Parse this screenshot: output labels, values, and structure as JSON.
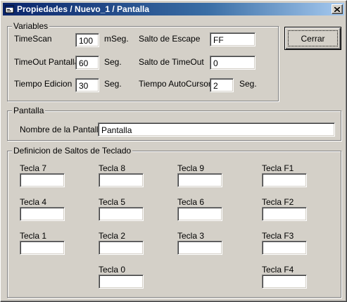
{
  "window": {
    "title": "Propiedades / Nuevo_1 / Pantalla",
    "icons": {
      "app": "app-window-icon",
      "close": "close-x-icon"
    }
  },
  "variables": {
    "legend": "Variables",
    "timescan_label": "TimeScan",
    "timescan_value": "100",
    "timescan_unit": "mSeg.",
    "timeout_label": "TimeOut Pantalla",
    "timeout_value": "60",
    "timeout_unit": "Seg.",
    "edicion_label": "Tiempo Edicion",
    "edicion_value": "30",
    "edicion_unit": "Seg.",
    "salto_escape_label": "Salto de Escape",
    "salto_escape_value": "FF",
    "salto_timeout_label": "Salto de TimeOut",
    "salto_timeout_value": "0",
    "autocursor_label": "Tiempo AutoCursor",
    "autocursor_value": "2",
    "autocursor_unit": "Seg."
  },
  "buttons": {
    "close_label": "Cerrar"
  },
  "pantalla": {
    "legend": "Pantalla",
    "name_label": "Nombre de la Pantalla:",
    "name_value": "Pantalla"
  },
  "saltos": {
    "legend": "Definicion de Saltos de Teclado",
    "keys": [
      {
        "label": "Tecla 7",
        "value": ""
      },
      {
        "label": "Tecla 8",
        "value": ""
      },
      {
        "label": "Tecla 9",
        "value": ""
      },
      {
        "label": "Tecla F1",
        "value": ""
      },
      {
        "label": "Tecla 4",
        "value": ""
      },
      {
        "label": "Tecla 5",
        "value": ""
      },
      {
        "label": "Tecla 6",
        "value": ""
      },
      {
        "label": "Tecla F2",
        "value": ""
      },
      {
        "label": "Tecla 1",
        "value": ""
      },
      {
        "label": "Tecla 2",
        "value": ""
      },
      {
        "label": "Tecla 3",
        "value": ""
      },
      {
        "label": "Tecla F3",
        "value": ""
      },
      {
        "label": "Tecla 0",
        "value": ""
      },
      {
        "label": "Tecla F4",
        "value": ""
      }
    ]
  }
}
